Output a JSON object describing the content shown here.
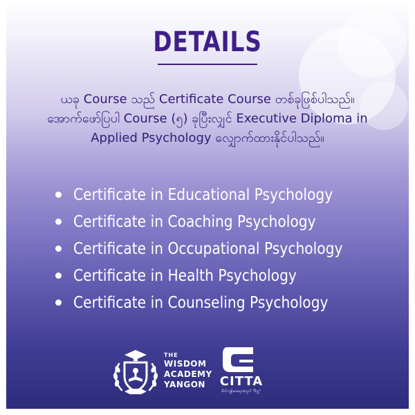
{
  "header": {
    "title": "DETAILS"
  },
  "intro": {
    "lines": [
      "ယခု Course သည် Certificate Course တစ်ခုဖြစ်ပါသည်။",
      "အောက်ဖော်ပြပါ Course (၅) ခုပြီးလျှင် Executive Diploma in",
      "Applied Psychology လျှောက်ထားနိုင်ပါသည်။"
    ]
  },
  "courses": [
    "Certificate in Educational Psychology",
    "Certificate in Coaching Psychology",
    "Certificate in Occupational Psychology",
    "Certificate in Health Psychology",
    "Certificate in Counseling Psychology"
  ],
  "logos": {
    "wisdom_academy": {
      "line1": "THE",
      "line2": "WISDOM",
      "line3": "ACADEMY",
      "line4": "YANGON"
    },
    "citta": {
      "name": "CITTA",
      "tagline": "စိတ်ကျန်းမာရေးအတွက် \"စိတ္တ\""
    }
  },
  "colors": {
    "title": "#3f1f86",
    "intro_text": "#2f1d78",
    "list_text": "#ffffff",
    "gradient_top": "#ffffff",
    "gradient_bottom": "#2c2a7a"
  }
}
